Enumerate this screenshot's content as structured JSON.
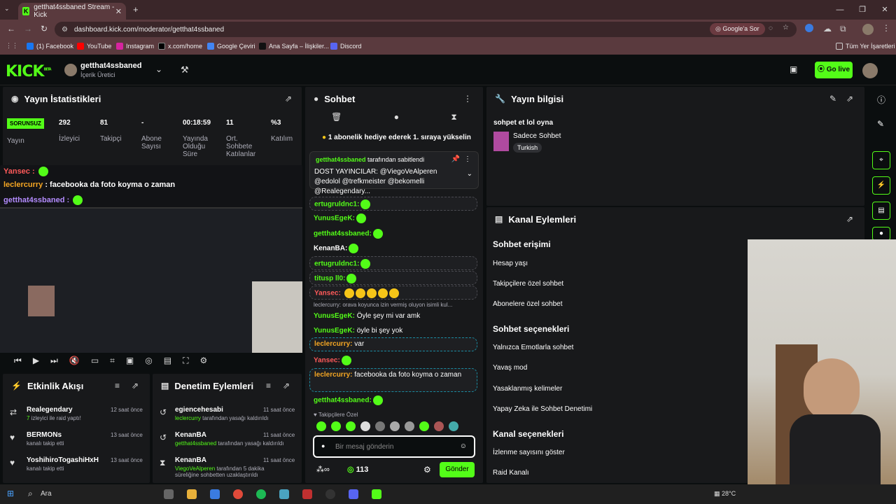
{
  "browser": {
    "tab_title": "getthat4ssbaned Stream - Kick",
    "url": "dashboard.kick.com/moderator/getthat4ssbaned",
    "google_label": "Google'a Sor",
    "bookmarks": [
      "(1) Facebook",
      "YouTube",
      "Instagram",
      "x.com/home",
      "Google Çeviri",
      "Ana Sayfa – İlişkiler...",
      "Discord"
    ],
    "all_bookmarks": "Tüm Yer İşaretleri"
  },
  "kick": {
    "logo": "KICK",
    "beta": "BETA",
    "channel": "getthat4ssbaned",
    "role": "İçerik Üretici",
    "go_live": "Go live"
  },
  "stats": {
    "title": "Yayın İstatistikleri",
    "status_badge": "SORUNSUZ",
    "status_label": "Yayın",
    "items": [
      {
        "value": "292",
        "label": "İzleyici"
      },
      {
        "value": "81",
        "label": "Takipçi"
      },
      {
        "value": "-",
        "label": "Abone Sayısı"
      },
      {
        "value": "00:18:59",
        "label": "Yayında Olduğu Süre"
      },
      {
        "value": "11",
        "label": "Ort. Sohbete Katılanlar"
      },
      {
        "value": "%3",
        "label": "Katılım"
      }
    ]
  },
  "overlay": {
    "line1_user": "Yansec",
    "line2_user": "leclercurry",
    "line2_text": "facebooka da foto koyma o zaman",
    "line3_user": "getthat4ssbaned"
  },
  "activity": {
    "title": "Etkinlik Akışı",
    "rows": [
      {
        "name": "Realegendary",
        "sub_hl": "7",
        "sub": "izleyici ile raid yaptı!",
        "time": "12 saat önce"
      },
      {
        "name": "BERMONs",
        "sub": "kanalı takip etti",
        "time": "13 saat önce"
      },
      {
        "name": "YoshihiroTogashiHxH",
        "sub": "kanalı takip etti",
        "time": "13 saat önce"
      }
    ]
  },
  "moderation": {
    "title": "Denetim Eylemleri",
    "rows": [
      {
        "name": "egiencehesabi",
        "actor": "leclercurry",
        "sub": "tarafından yasağı kaldırıldı",
        "time": "11 saat önce"
      },
      {
        "name": "KenanBA",
        "actor": "getthat4ssbaned",
        "sub": "tarafından yasağı kaldırıldı",
        "time": "11 saat önce"
      },
      {
        "name": "KenanBA",
        "actor": "ViegoVeAlperen",
        "sub": "tarafından 5 dakika süreliğine sohbetten uzaklaştırıldı",
        "time": "11 saat önce"
      }
    ]
  },
  "chat": {
    "title": "Sohbet",
    "gift_banner": "1 abonelik hediye ederek 1. sıraya yükselin",
    "pinned_by": "getthat4ssbaned",
    "pinned_suffix": "tarafından sabitlendi",
    "pinned_text": "DOST YAYINCILAR: @ViegoVeAlperen @edolol @trefkmeister @bekomelli @Realegendary...",
    "messages": [
      {
        "user": "leclercurry",
        "text": "",
        "color": "#53fc18"
      },
      {
        "user": "ertugruldnc1:",
        "text": "",
        "color": "#53fc18"
      },
      {
        "user": "YunusEgeK:",
        "text": "",
        "color": "#53fc18"
      },
      {
        "user": "getthat4ssbaned:",
        "text": "",
        "color": "#53fc18"
      },
      {
        "user": "KenanBA:",
        "text": "",
        "color": "#fff"
      },
      {
        "user": "ertugruldnc1:",
        "text": "",
        "color": "#53fc18"
      },
      {
        "user": "titusp ll0:",
        "text": "",
        "color": "#53fc18"
      },
      {
        "user": "Yansec:",
        "text": "",
        "color": "#ff5a5a"
      },
      {
        "user": "",
        "text": "leclercurry: orava koyunca izin vermiş oluyon isimli kul...",
        "color": "#adadb8"
      },
      {
        "user": "YunusEgeK:",
        "text": "Öyle şey mi var amk",
        "color": "#53fc18"
      },
      {
        "user": "YunusEgeK:",
        "text": "öyle bi şey yok",
        "color": "#53fc18"
      },
      {
        "user": "leclercurry:",
        "text": "var",
        "color": "#53fc18"
      },
      {
        "user": "Yansec:",
        "text": "",
        "color": "#ff5a5a"
      },
      {
        "user": "leclercurry:",
        "text": "facebooka da foto koyma o zaman",
        "color": "#53fc18"
      },
      {
        "user": "getthat4ssbaned:",
        "text": "",
        "color": "#53fc18"
      }
    ],
    "followers_only": "Takipçilere Özel",
    "placeholder": "Bir mesaj gönderin",
    "points": "113",
    "send": "Gönder"
  },
  "info": {
    "title": "Yayın bilgisi",
    "stream_title": "sohpet et lol oyna",
    "category": "Sadece Sohbet",
    "language": "Turkish"
  },
  "channel_actions": {
    "title": "Kanal Eylemleri",
    "chat_access": "Sohbet erişimi",
    "account_age": "Hesap yaşı",
    "followers_only": "Takipçilere özel sohbet",
    "subs_only": "Abonelere özel sohbet",
    "chat_options": "Sohbet seçenekleri",
    "emotes_only": "Yalnızca Emotlarla sohbet",
    "slow_mode": "Yavaş mod",
    "banned_words": "Yasaklanmış kelimeler",
    "ai_mod": "Yapay Zeka ile Sohbet Denetimi",
    "channel_options": "Kanal seçenekleri",
    "show_viewers": "İzlenme sayısını göster",
    "raid": "Raid Kanalı"
  },
  "taskbar": {
    "search": "Ara",
    "temp": "28°C"
  }
}
